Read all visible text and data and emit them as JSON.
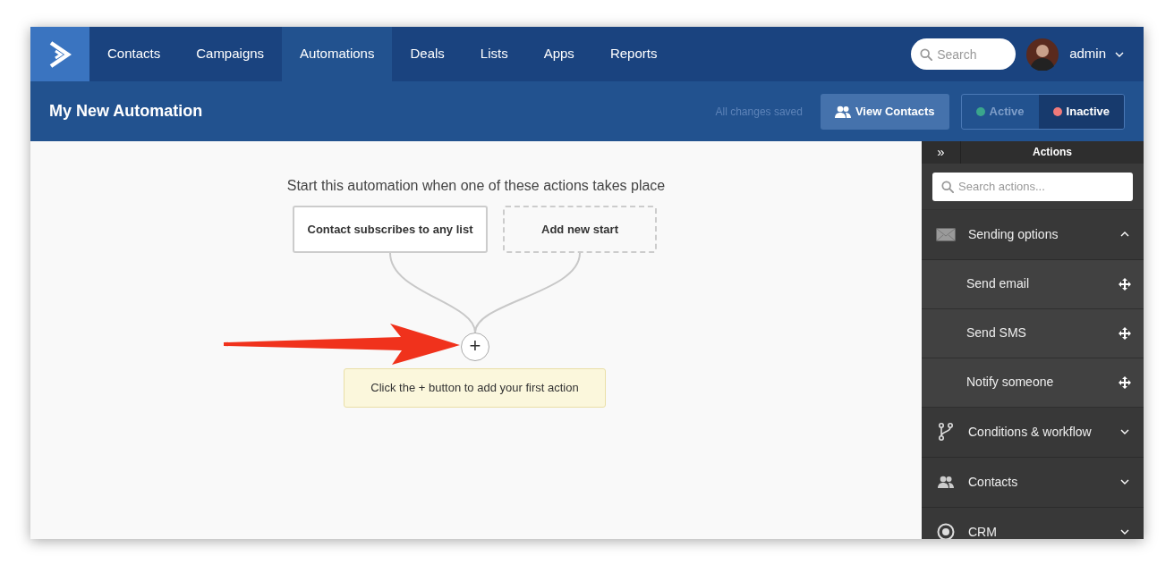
{
  "navbar": {
    "tabs": [
      {
        "label": "Contacts",
        "selected": false
      },
      {
        "label": "Campaigns",
        "selected": false
      },
      {
        "label": "Automations",
        "selected": true
      },
      {
        "label": "Deals",
        "selected": false
      },
      {
        "label": "Lists",
        "selected": false
      },
      {
        "label": "Apps",
        "selected": false
      },
      {
        "label": "Reports",
        "selected": false
      }
    ],
    "search": {
      "placeholder": "Search"
    },
    "user": "admin"
  },
  "header": {
    "title": "My New Automation",
    "save_status": "All changes saved",
    "view_contacts_button": "View Contacts",
    "status_toggle": [
      {
        "label": "Active",
        "selected": false,
        "color": "#3aa58c"
      },
      {
        "label": "Inactive",
        "selected": true,
        "color": "#f07a7a"
      }
    ]
  },
  "canvas": {
    "heading": "Start this automation when one of these actions takes place",
    "triggers": [
      {
        "label": "Contact subscribes to any list",
        "kind": "trigger"
      },
      {
        "label": "Add new start",
        "kind": "placeholder"
      }
    ],
    "add_button": "+",
    "tooltip": "Click the + button to add your first action"
  },
  "sidebar": {
    "collapse": "»",
    "title": "Actions",
    "search": {
      "placeholder": "Search actions..."
    },
    "sections": [
      {
        "label": "Sending options",
        "expanded": true,
        "children": [
          {
            "label": "Send email"
          },
          {
            "label": "Send SMS"
          },
          {
            "label": "Notify someone"
          }
        ]
      },
      {
        "label": "Conditions & workflow",
        "expanded": false
      },
      {
        "label": "Contacts",
        "expanded": false
      },
      {
        "label": "CRM",
        "expanded": false
      }
    ]
  }
}
